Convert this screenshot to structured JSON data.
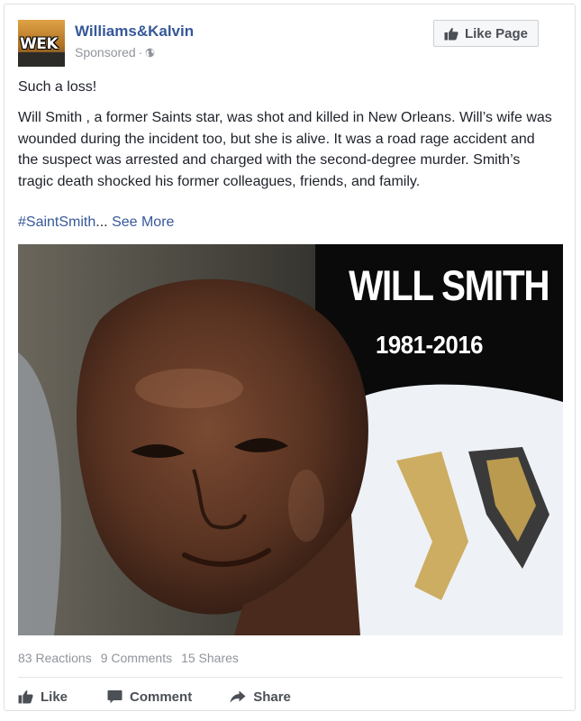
{
  "post": {
    "page_name": "Williams&Kalvin",
    "avatar_text": "WEK",
    "sponsored_label": "Sponsored",
    "sponsored_separator": "·",
    "like_page_label": "Like Page",
    "headline": "Such a loss!",
    "body": "Will Smith , a former Saints star, was shot and killed in New Orleans. Will’s wife was wounded during the incident too, but she is alive. It was a road rage accident and the suspect was arrested and charged with the second-degree murder. Smith’s tragic death shocked his former colleagues, friends, and family.",
    "hashtag": "#SaintSmith",
    "ellipsis": "...",
    "see_more": "See More",
    "image": {
      "title": "WILL SMITH",
      "years": "1981-2016"
    }
  },
  "stats": {
    "reactions": "83 Reactions",
    "comments": "9 Comments",
    "shares": "15 Shares"
  },
  "actions": {
    "like_label": "Like",
    "comment_label": "Comment",
    "share_label": "Share"
  },
  "colors": {
    "link": "#365899",
    "text": "#1d2129",
    "meta": "#90949c",
    "action": "#4b4f56"
  },
  "icons": {
    "privacy": "globe-icon",
    "like_page": "thumbs-up-icon",
    "like": "thumbs-up-icon",
    "comment": "speech-bubble-icon",
    "share": "share-arrow-icon"
  }
}
